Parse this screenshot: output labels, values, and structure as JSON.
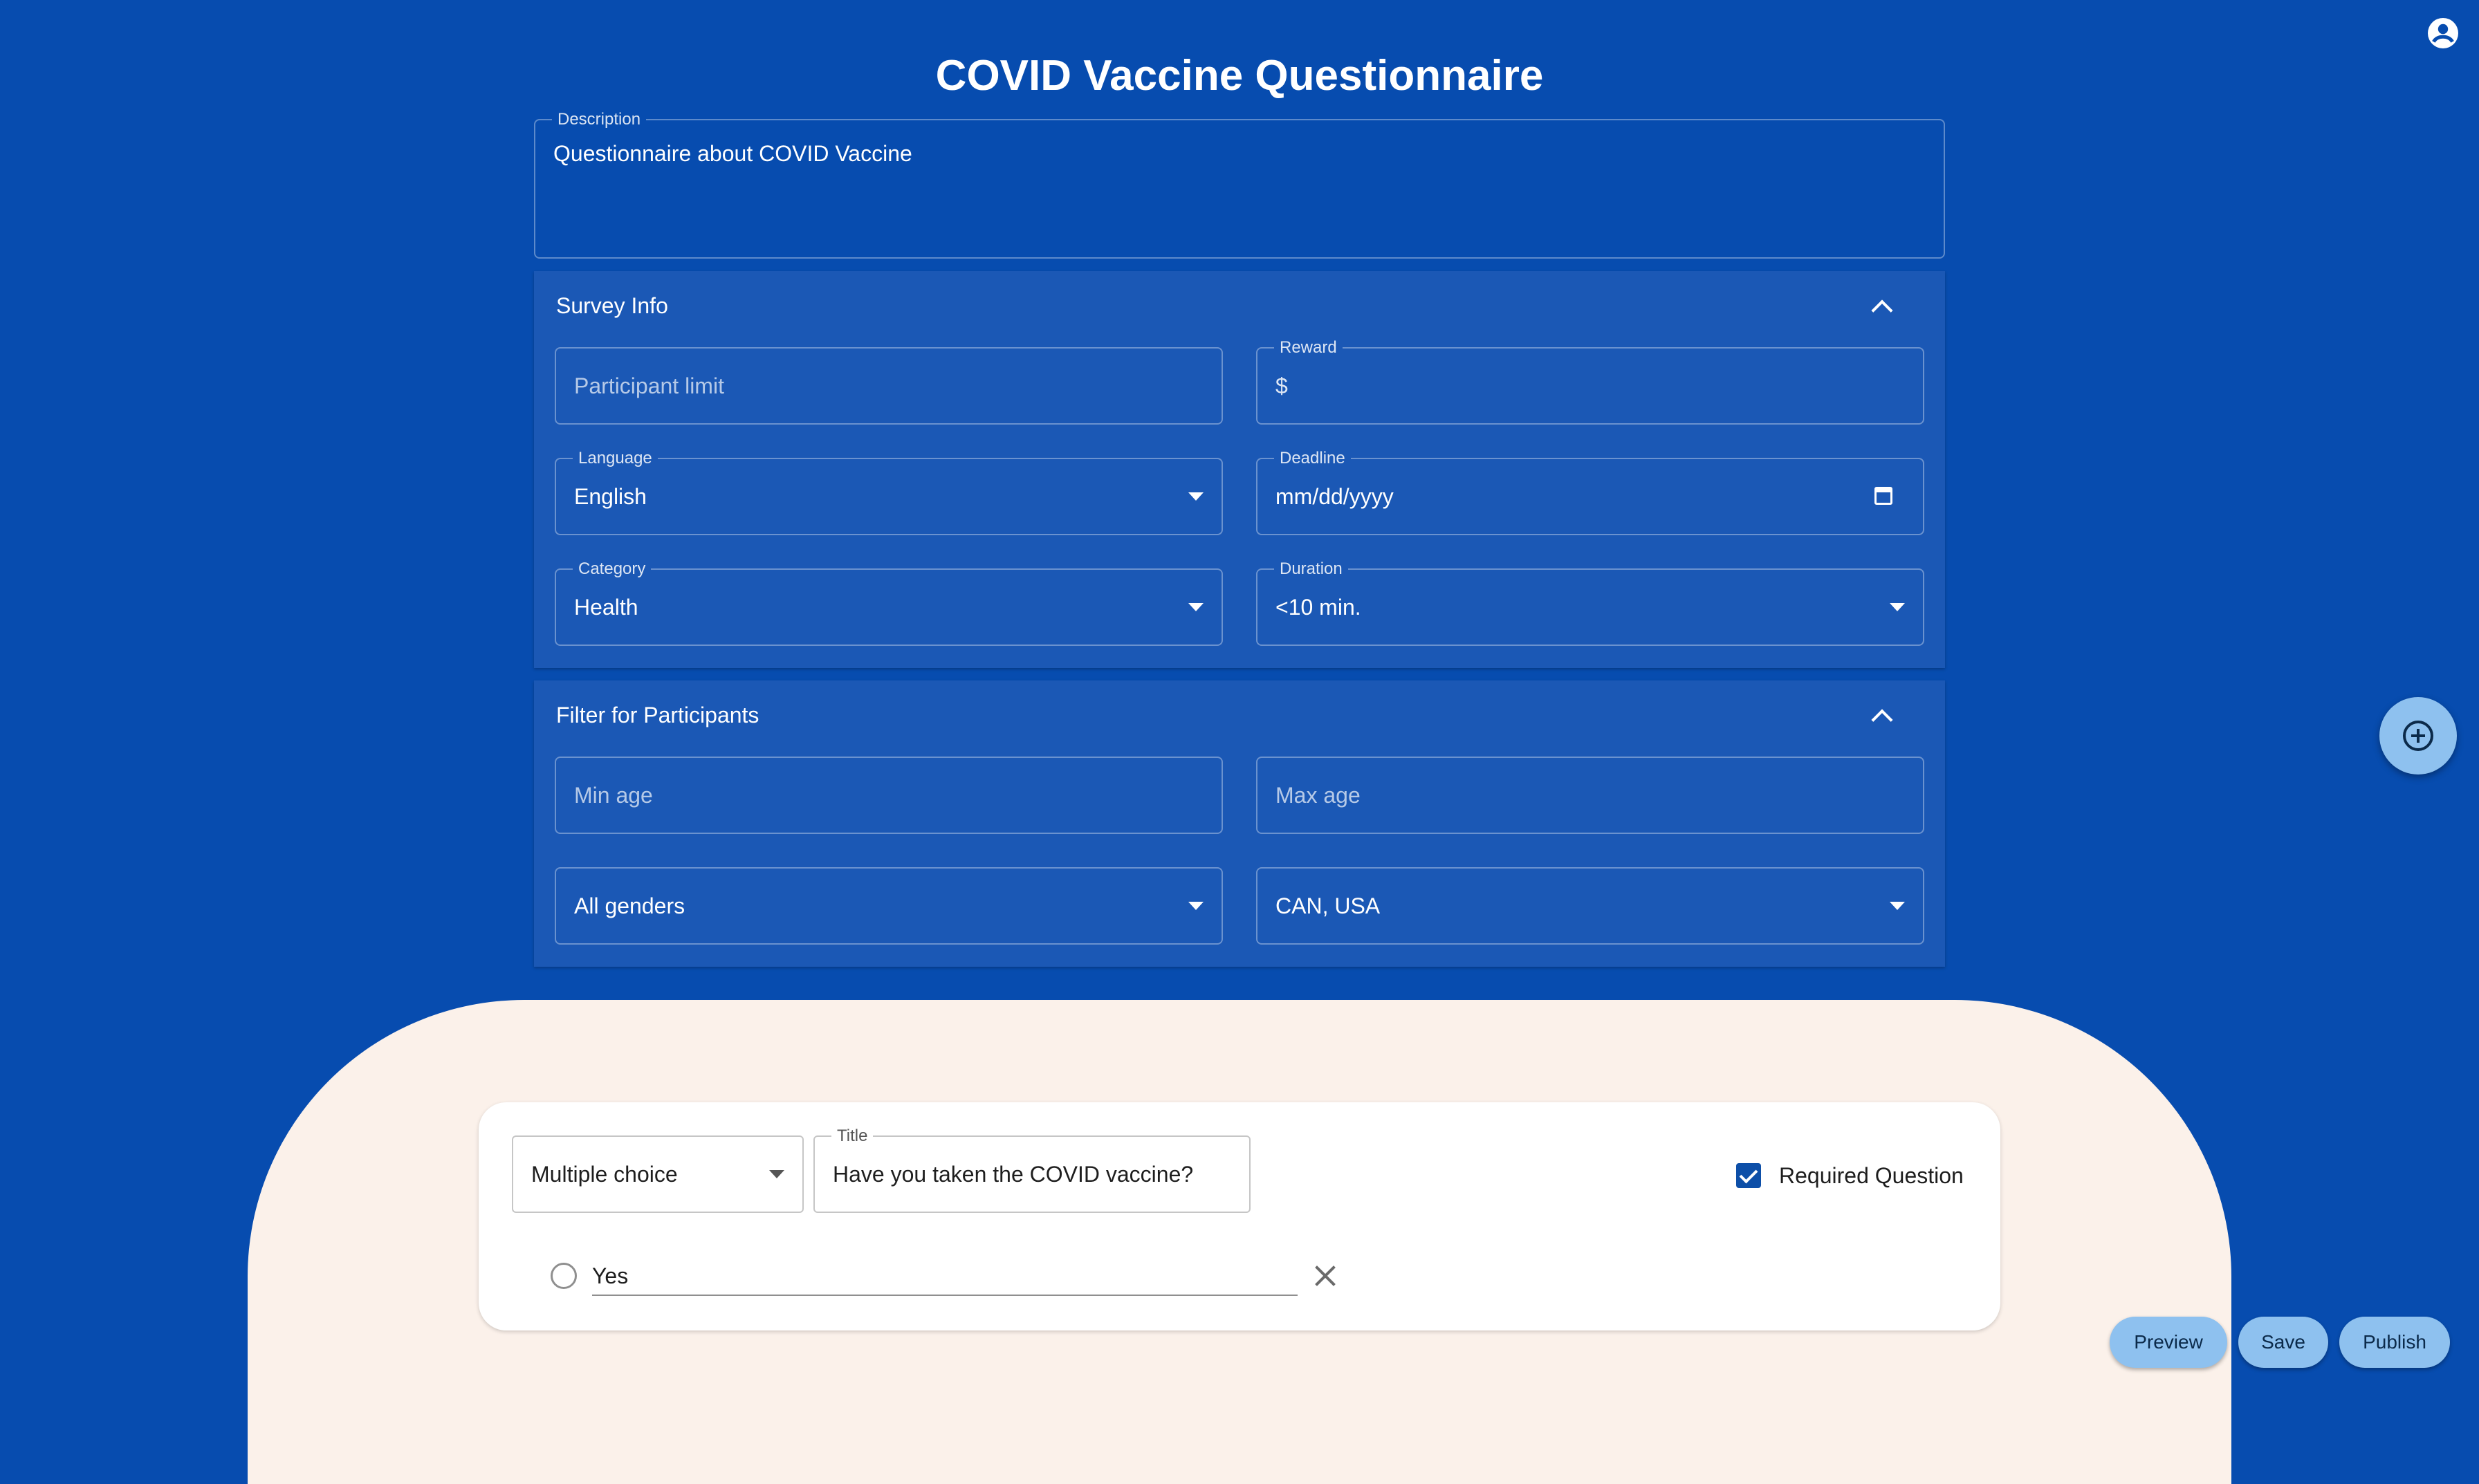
{
  "page": {
    "title": "COVID Vaccine Questionnaire"
  },
  "description": {
    "label": "Description",
    "value": "Questionnaire about COVID Vaccine"
  },
  "survey_info": {
    "header": "Survey Info",
    "participant_limit_placeholder": "Participant limit",
    "reward_label": "Reward",
    "reward_prefix": "$",
    "language_label": "Language",
    "language_value": "English",
    "deadline_label": "Deadline",
    "deadline_placeholder": "mm/dd/yyyy",
    "category_label": "Category",
    "category_value": "Health",
    "duration_label": "Duration",
    "duration_value": "<10 min."
  },
  "filter": {
    "header": "Filter for Participants",
    "min_age_placeholder": "Min age",
    "max_age_placeholder": "Max age",
    "gender_value": "All genders",
    "country_value": "CAN, USA"
  },
  "question": {
    "type_value": "Multiple choice",
    "title_label": "Title",
    "title_value": "Have you taken the COVID vaccine?",
    "required_label": "Required Question",
    "required_checked": true,
    "options": [
      "Yes"
    ]
  },
  "actions": {
    "preview": "Preview",
    "save": "Save",
    "publish": "Publish"
  },
  "icons": {
    "account": "account-circle-icon",
    "fab": "add-circle-icon",
    "calendar": "calendar-icon",
    "remove": "close-icon",
    "collapse": "chevron-up-icon",
    "dropdown": "arrow-drop-down-icon"
  },
  "colors": {
    "background": "#074caf",
    "panel": "#1b58b5",
    "cream": "#fbf1ea",
    "button": "#8ec1ef",
    "checkbox": "#0d4fa8"
  }
}
